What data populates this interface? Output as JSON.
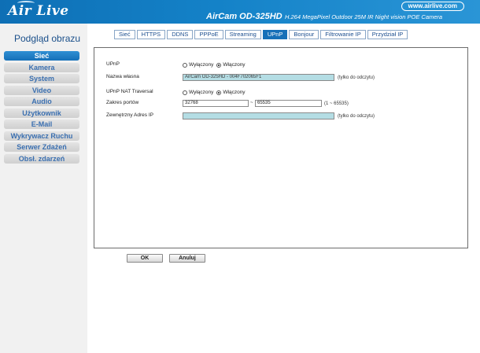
{
  "header": {
    "logo": "Air Live",
    "site_link": "www.airlive.com",
    "model": "AirCam OD-325HD",
    "model_desc": "H.264 MegaPixel Outdoor 25M IR Night vision POE Camera"
  },
  "sidebar": {
    "title": "Podgląd obrazu",
    "items": [
      {
        "label": "Sieć",
        "active": true
      },
      {
        "label": "Kamera"
      },
      {
        "label": "System"
      },
      {
        "label": "Video"
      },
      {
        "label": "Audio"
      },
      {
        "label": "Użytkownik"
      },
      {
        "label": "E-Mail"
      },
      {
        "label": "Wykrywacz Ruchu"
      },
      {
        "label": "Serwer Zdażeń"
      },
      {
        "label": "Obsł. zdarzeń"
      }
    ]
  },
  "tabs": [
    "Sieć",
    "HTTPS",
    "DDNS",
    "PPPoE",
    "Streaming",
    "UPnP",
    "Bonjour",
    "Filtrowanie IP",
    "Przydział IP"
  ],
  "active_tab": "UPnP",
  "form": {
    "upnp": {
      "label": "UPnP",
      "off_label": "Wyłączony",
      "on_label": "Włączony",
      "selected": "on"
    },
    "friendly_name": {
      "label": "Nazwa własna",
      "value": "AirCam OD-325HD - 004F702065F1",
      "note": "(tylko do odczytu)"
    },
    "nat_traversal": {
      "label": "UPnP NAT Traversal",
      "off_label": "Wyłączony",
      "on_label": "Włączony",
      "selected": "on"
    },
    "port_range": {
      "label": "Zakres portów",
      "from": "32768",
      "separator": "~",
      "to": "65535",
      "hint": "(1 ~ 65535)"
    },
    "external_ip": {
      "label": "Zewnętrzny Adres IP",
      "value": "",
      "note": "(tylko do odczytu)"
    }
  },
  "buttons": {
    "ok": "OK",
    "cancel": "Anuluj"
  }
}
